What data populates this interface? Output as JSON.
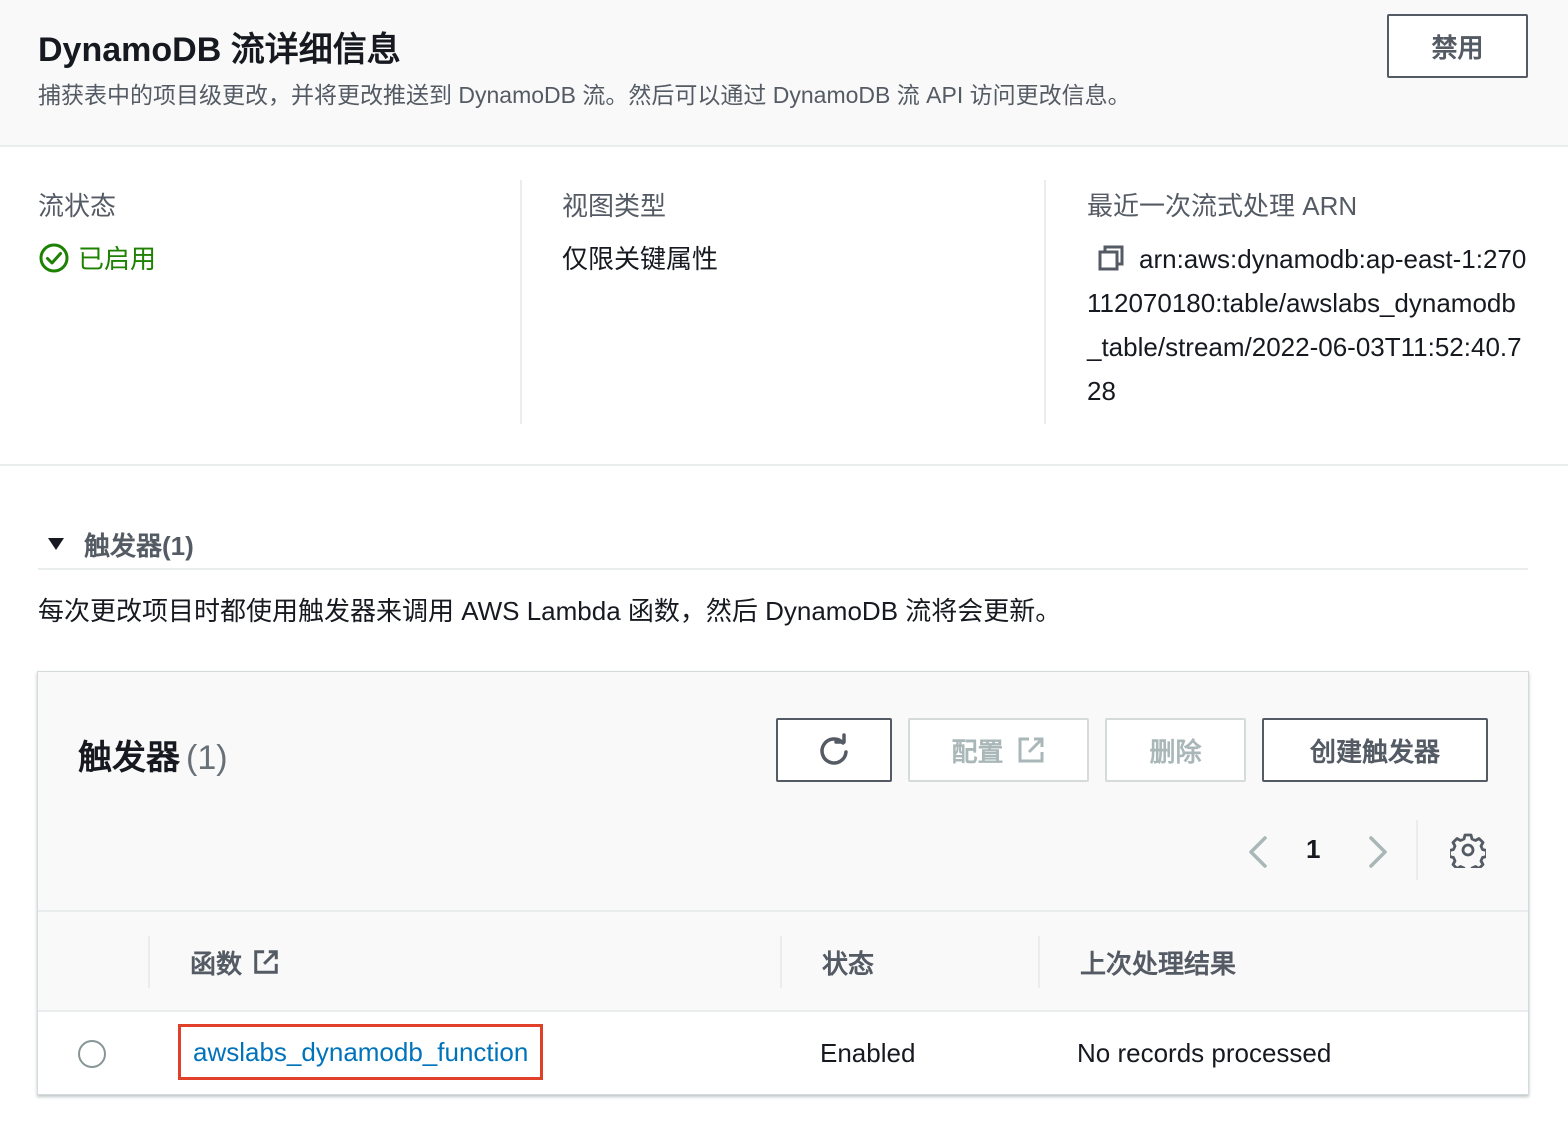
{
  "header": {
    "title": "DynamoDB 流详细信息",
    "description": "捕获表中的项目级更改，并将更改推送到 DynamoDB 流。然后可以通过 DynamoDB 流 API 访问更改信息。",
    "disable_button": "禁用"
  },
  "details": {
    "stream_status_label": "流状态",
    "stream_status_value": "已启用",
    "view_type_label": "视图类型",
    "view_type_value": "仅限关键属性",
    "arn_label": "最近一次流式处理 ARN",
    "arn_value": "arn:aws:dynamodb:ap-east-1:270112070180:table/awslabs_dynamodb_table/stream/2022-06-03T11:52:40.728"
  },
  "triggers_section": {
    "title": "触发器(1)",
    "description": "每次更改项目时都使用触发器来调用 AWS Lambda 函数，然后 DynamoDB 流将会更新。"
  },
  "triggers_table": {
    "title": "触发器",
    "count": "(1)",
    "configure_button": "配置",
    "delete_button": "删除",
    "create_button": "创建触发器",
    "page_number": "1",
    "columns": {
      "function": "函数",
      "status": "状态",
      "last_result": "上次处理结果"
    },
    "rows": [
      {
        "function": "awslabs_dynamodb_function",
        "status": "Enabled",
        "last_result": "No records processed"
      }
    ]
  },
  "colors": {
    "success": "#1d8102",
    "link": "#0073bb",
    "highlight_box": "#e0402a"
  },
  "icons": [
    "check-circle-icon",
    "copy-icon",
    "caret-down-icon",
    "refresh-icon",
    "external-link-icon",
    "chevron-left-icon",
    "chevron-right-icon",
    "gear-icon"
  ]
}
